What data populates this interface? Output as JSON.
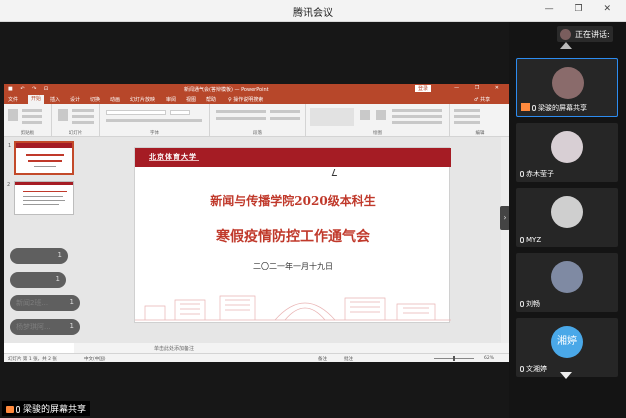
{
  "window": {
    "title": "腾讯会议",
    "controls": "— ❐ ✕"
  },
  "powerpoint": {
    "quick_access": "■ ↶ ↷ ⊡",
    "doc_title": "新闻通气会(答辩模板) — PowerPoint",
    "login_button": "登录",
    "window_controls": "— ❐ ✕",
    "tabs": [
      "文件",
      "开始",
      "插入",
      "设计",
      "切换",
      "动画",
      "幻灯片放映",
      "审阅",
      "视图",
      "帮助",
      "♀ 操作说明搜索"
    ],
    "share_button": "♂ 共享",
    "ribbon_groups": [
      "剪贴板",
      "幻灯片",
      "字体",
      "段落",
      "绘图",
      "编辑"
    ],
    "notes_placeholder": "单击此处添加备注",
    "status": {
      "slide_info": "幻灯片 第 1 张，共 2 张",
      "language": "中文(中国)",
      "notes_btn": "备注",
      "comments_btn": "批注",
      "zoom": "62%"
    }
  },
  "slide": {
    "logo_text": "北京体育大学",
    "line1": "新闻与传播学院2020级本科生",
    "line2": "寒假疫情防控工作通气会",
    "date": "二〇二一年一月十九日"
  },
  "thumbnails": [
    {
      "number": "1"
    },
    {
      "number": "2"
    }
  ],
  "notifications": [
    {
      "text": "",
      "count": "1"
    },
    {
      "text": "",
      "count": "1"
    },
    {
      "text": "新闻2班...",
      "count": "1"
    },
    {
      "text": "杨梦琪阿...",
      "count": "1"
    }
  ],
  "sharer_label": "梁骏的屏幕共享",
  "side_panel": {
    "speaking_label": "正在讲话:",
    "participants": [
      {
        "name": "梁骏的屏幕共享",
        "avatar_color": "#8a6b6b"
      },
      {
        "name": "赤木莹子",
        "avatar_color": "#d8cfd4"
      },
      {
        "name": "MYZ",
        "avatar_color": "#cfcfcf"
      },
      {
        "name": "刘畅",
        "avatar_color": "#7f8aa3"
      },
      {
        "name": "文湘婷",
        "avatar_color": "#4aa8e8",
        "avatar_text": "湘婷"
      }
    ]
  }
}
